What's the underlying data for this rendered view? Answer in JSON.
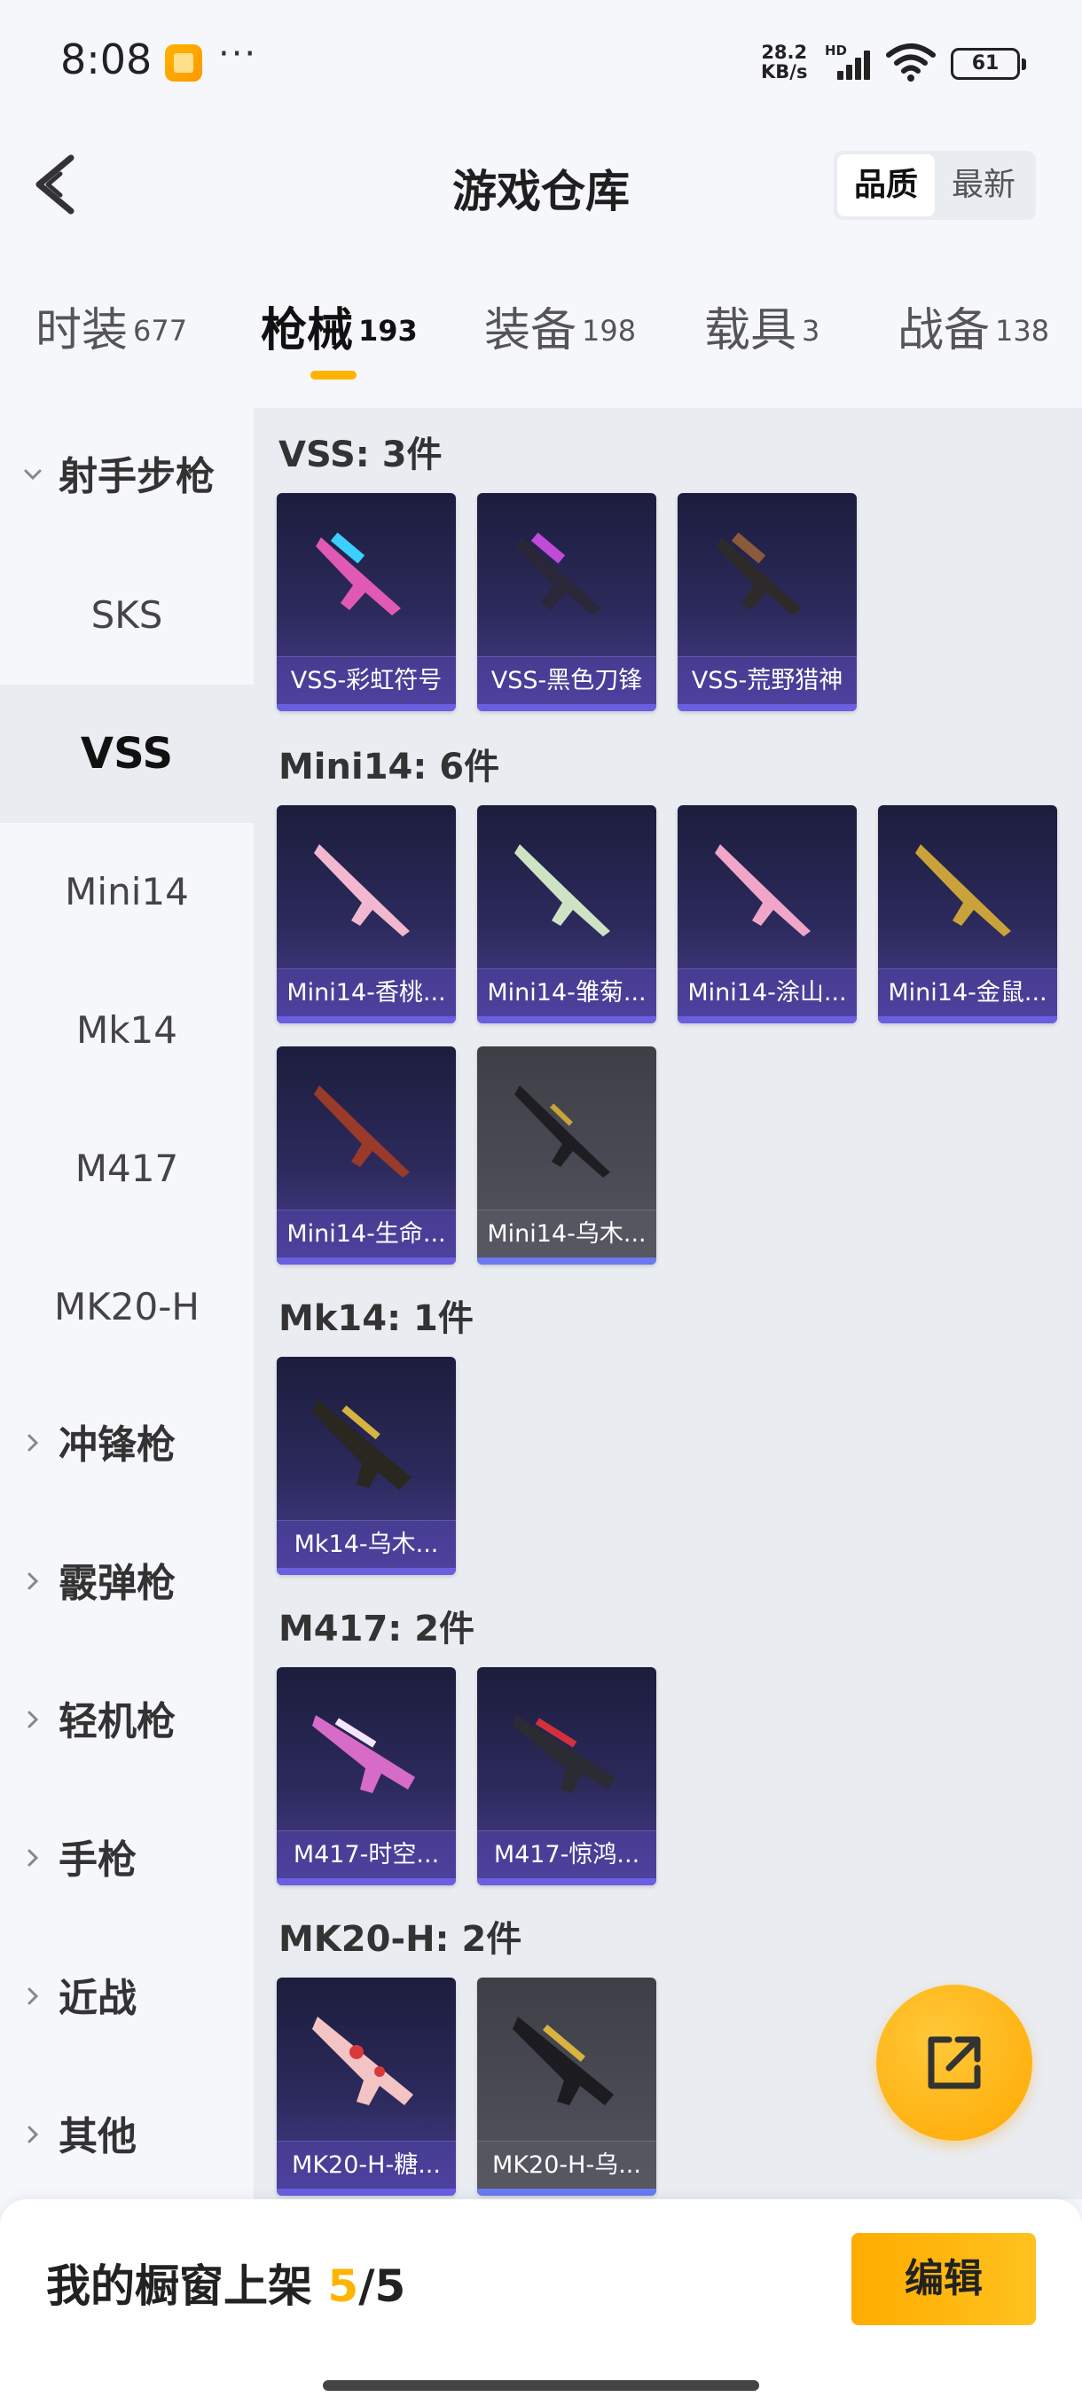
{
  "status_bar": {
    "time": "8:08",
    "more": "···",
    "net_speed_value": "28.2",
    "net_speed_unit": "KB/s",
    "hd_label": "HD",
    "battery": "61"
  },
  "header": {
    "title": "游戏仓库",
    "sort_options": [
      "品质",
      "最新"
    ],
    "active_sort": "品质"
  },
  "category_tabs": [
    {
      "label": "时装",
      "count": "677"
    },
    {
      "label": "枪械",
      "count": "193",
      "active": true
    },
    {
      "label": "装备",
      "count": "198"
    },
    {
      "label": "载具",
      "count": "3"
    },
    {
      "label": "战备",
      "count": "138"
    }
  ],
  "sidebar": {
    "items": [
      {
        "label": "射手步枪",
        "type": "group",
        "expanded": true
      },
      {
        "label": "SKS",
        "type": "sub"
      },
      {
        "label": "VSS",
        "type": "sub",
        "active": true
      },
      {
        "label": "Mini14",
        "type": "sub"
      },
      {
        "label": "Mk14",
        "type": "sub"
      },
      {
        "label": "M417",
        "type": "sub"
      },
      {
        "label": "MK20-H",
        "type": "sub"
      },
      {
        "label": "冲锋枪",
        "type": "group"
      },
      {
        "label": "霰弹枪",
        "type": "group"
      },
      {
        "label": "轻机枪",
        "type": "group"
      },
      {
        "label": "手枪",
        "type": "group"
      },
      {
        "label": "近战",
        "type": "group"
      },
      {
        "label": "其他",
        "type": "group"
      }
    ]
  },
  "groups": [
    {
      "title": "VSS: 3件",
      "items": [
        "VSS-彩虹符号",
        "VSS-黑色刀锋",
        "VSS-荒野猎神"
      ]
    },
    {
      "title": "Mini14: 6件",
      "items": [
        "Mini14-香桃...",
        "Mini14-雏菊...",
        "Mini14-涂山...",
        "Mini14-金鼠...",
        "Mini14-生命...",
        "Mini14-乌木..."
      ]
    },
    {
      "title": "Mk14: 1件",
      "items": [
        "Mk14-乌木..."
      ]
    },
    {
      "title": "M417: 2件",
      "items": [
        "M417-时空...",
        "M417-惊鸿..."
      ]
    },
    {
      "title": "MK20-H: 2件",
      "items": [
        "MK20-H-糖...",
        "MK20-H-乌..."
      ]
    }
  ],
  "colors": {
    "accent": "#ffb400",
    "card_purple": "#4a3f94",
    "card_grey": "#55565f"
  },
  "bottom_bar": {
    "label": "我的橱窗上架",
    "listed": "5",
    "separator": "/",
    "capacity": "5",
    "edit_label": "编辑"
  },
  "icons": {
    "back": "chevron-left-icon",
    "share": "share-external-icon",
    "collapse": "chevron-down-icon",
    "expand": "chevron-right-icon"
  }
}
